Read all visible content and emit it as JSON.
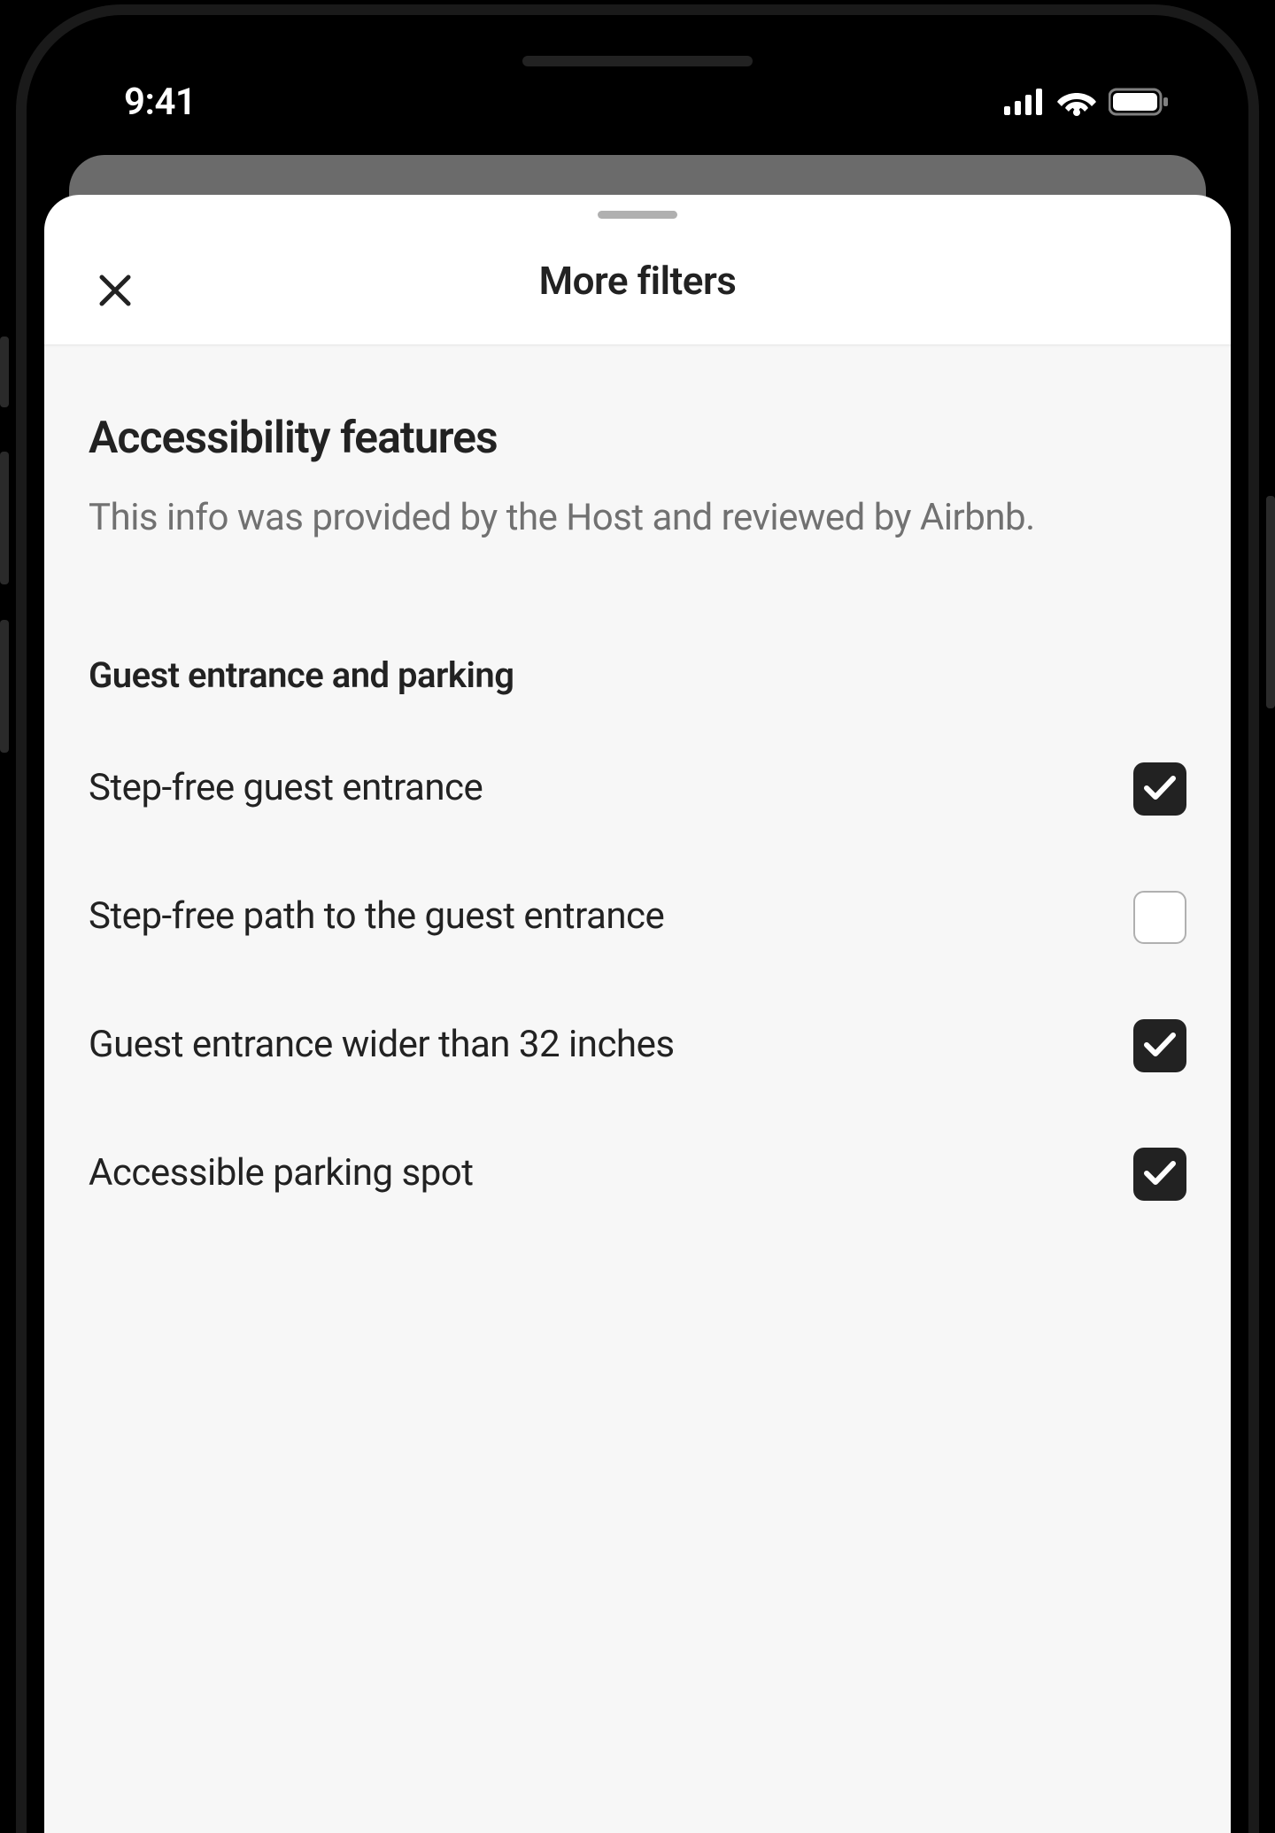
{
  "statusBar": {
    "time": "9:41"
  },
  "sheet": {
    "headerTitle": "More filters",
    "section": {
      "title": "Accessibility features",
      "subtitle": "This info was provided by the Host and reviewed by Airbnb.",
      "subsection": {
        "title": "Guest entrance and parking",
        "options": [
          {
            "label": "Step-free guest entrance",
            "checked": true
          },
          {
            "label": "Step-free path to the guest entrance",
            "checked": false
          },
          {
            "label": "Guest entrance wider than 32 inches",
            "checked": true
          },
          {
            "label": "Accessible parking spot",
            "checked": true
          }
        ]
      }
    }
  }
}
